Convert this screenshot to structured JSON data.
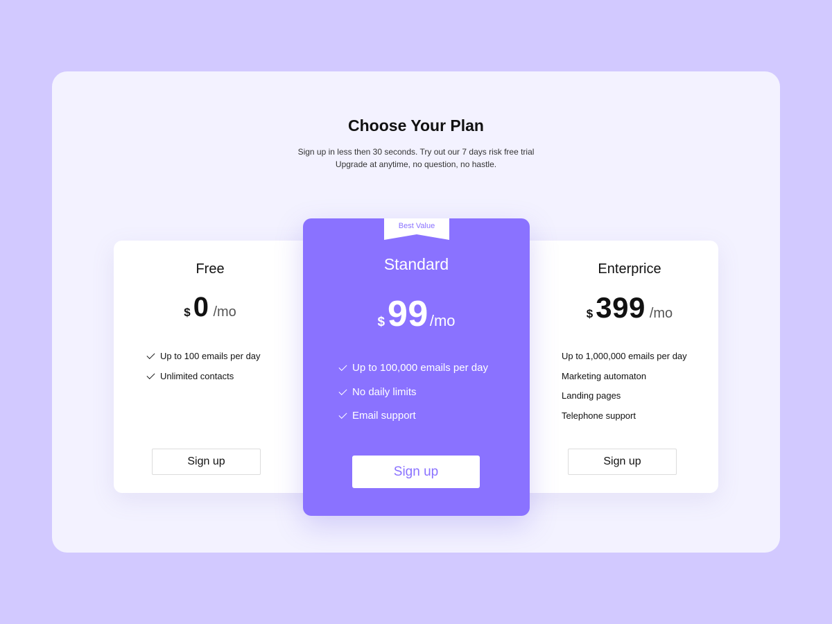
{
  "header": {
    "title": "Choose Your Plan",
    "subtitle_line1": "Sign up in less then 30 seconds. Try out our 7 days risk free trial",
    "subtitle_line2": "Upgrade at anytime, no question, no hastle."
  },
  "plans": [
    {
      "name": "Free",
      "currency": "$",
      "amount": "0",
      "period": "/mo",
      "features": [
        "Up to 100 emails per day",
        "Unlimited contacts"
      ],
      "button": "Sign up"
    },
    {
      "name": "Standard",
      "badge": "Best Value",
      "currency": "$",
      "amount": "99",
      "period": "/mo",
      "features": [
        "Up to 100,000 emails per day",
        "No daily limits",
        "Email support"
      ],
      "button": "Sign up"
    },
    {
      "name": "Enterprice",
      "currency": "$",
      "amount": "399",
      "period": "/mo",
      "features": [
        "Up to 1,000,000 emails per day",
        "Marketing automaton",
        "Landing pages",
        "Telephone support"
      ],
      "button": "Sign up"
    }
  ],
  "colors": {
    "background": "#d2c9ff",
    "panel": "#f3f2ff",
    "accent": "#8a72ff",
    "card": "#ffffff"
  },
  "icons": {
    "feature_marker": "check-icon",
    "badge": "ribbon-badge"
  }
}
